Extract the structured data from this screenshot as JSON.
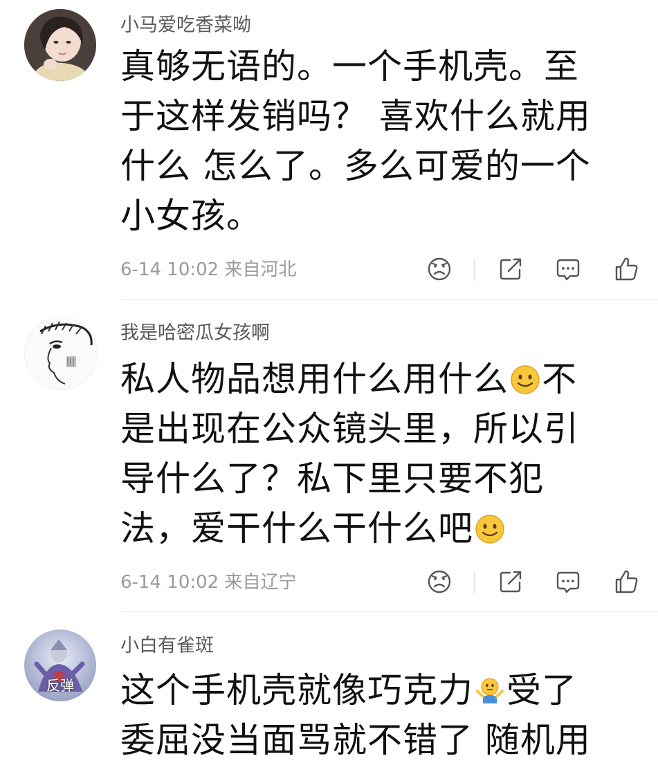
{
  "comments": [
    {
      "username": "小马爱吃香菜呦",
      "lines": [
        "真够无语的。一个手机壳。至",
        "于这样发销吗？  喜欢什么就用",
        "什么 怎么了。多么可爱的一个",
        "小女孩。"
      ],
      "timestamp": "6-14 10:02",
      "location": "来自河北"
    },
    {
      "username": "我是哈密瓜女孩啊",
      "lines": [
        "私人物品想用什么用什么",
        "不",
        "是出现在公众镜头里，所以引",
        "导什么了？私下里只要不犯",
        "法，爱干什么干什么吧"
      ],
      "timestamp": "6-14 10:02",
      "location": "来自辽宁"
    },
    {
      "username": "小白有雀斑",
      "avatar_badge": "反弹",
      "lines": [
        "这个手机壳就像巧克力",
        "受了",
        "委屈没当面骂就不错了 随机用"
      ]
    }
  ],
  "icons": {
    "dislike": "frown-face-icon",
    "share": "share-icon",
    "reply": "comment-bubble-icon",
    "like": "thumbs-up-icon",
    "smile_emoji": "smile-emoji-icon",
    "shrug_emoji": "shrug-emoji-icon"
  },
  "colors": {
    "username": "#5a5a5a",
    "body": "#111111",
    "meta": "#9a9a9a",
    "icon": "#555555",
    "divider": "#ececec"
  }
}
